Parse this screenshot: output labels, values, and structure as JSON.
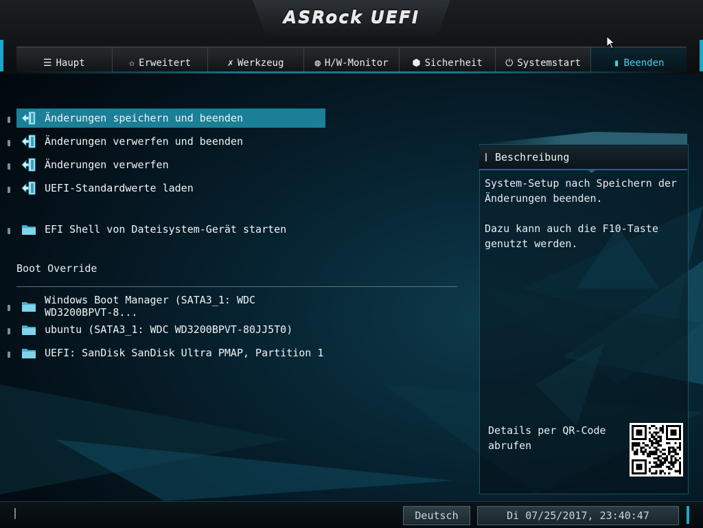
{
  "header": {
    "logo": "ASRock UEFI"
  },
  "tabs": [
    {
      "label": "Haupt",
      "icon": "list-icon",
      "glyph": "☰"
    },
    {
      "label": "Erweitert",
      "icon": "star-icon",
      "glyph": "✩"
    },
    {
      "label": "Werkzeug",
      "icon": "wrench-icon",
      "glyph": "✗"
    },
    {
      "label": "H/W-Monitor",
      "icon": "monitor-gauge-icon",
      "glyph": "◍"
    },
    {
      "label": "Sicherheit",
      "icon": "shield-icon",
      "glyph": "⬢"
    },
    {
      "label": "Systemstart",
      "icon": "power-icon",
      "glyph": "⏻"
    },
    {
      "label": "Beenden",
      "icon": "exit-door-icon",
      "glyph": "▮",
      "active": true
    }
  ],
  "menu": {
    "items": [
      {
        "label": "Änderungen speichern und beenden",
        "icon": "exit-arrow-icon",
        "selected": true
      },
      {
        "label": "Änderungen verwerfen und beenden",
        "icon": "exit-arrow-icon"
      },
      {
        "label": "Änderungen verwerfen",
        "icon": "exit-arrow-icon"
      },
      {
        "label": "UEFI-Standardwerte laden",
        "icon": "exit-arrow-icon"
      },
      {
        "label": "EFI Shell von Dateisystem-Gerät starten",
        "icon": "folder-icon"
      }
    ],
    "boot_override_title": "Boot Override",
    "boot_items": [
      {
        "label": "Windows Boot Manager (SATA3_1: WDC WD3200BPVT-8...",
        "icon": "folder-icon"
      },
      {
        "label": "ubuntu (SATA3_1: WDC WD3200BPVT-80JJ5T0)",
        "icon": "folder-icon"
      },
      {
        "label": "UEFI: SanDisk SanDisk Ultra PMAP, Partition 1",
        "icon": "folder-icon"
      }
    ]
  },
  "description": {
    "title": "Beschreibung",
    "text": "System-Setup nach Speichern der\nÄnderungen beenden.\n\nDazu kann auch die F10-Taste\ngenutzt werden.",
    "qr_text": "Details per QR-Code\nabrufen"
  },
  "footer": {
    "language": "Deutsch",
    "datetime": "Di 07/25/2017, 23:40:47"
  },
  "colors": {
    "accent": "#1ec3e6",
    "selected_row": "#1a7f97",
    "active_tab_text": "#3fd0ef"
  }
}
